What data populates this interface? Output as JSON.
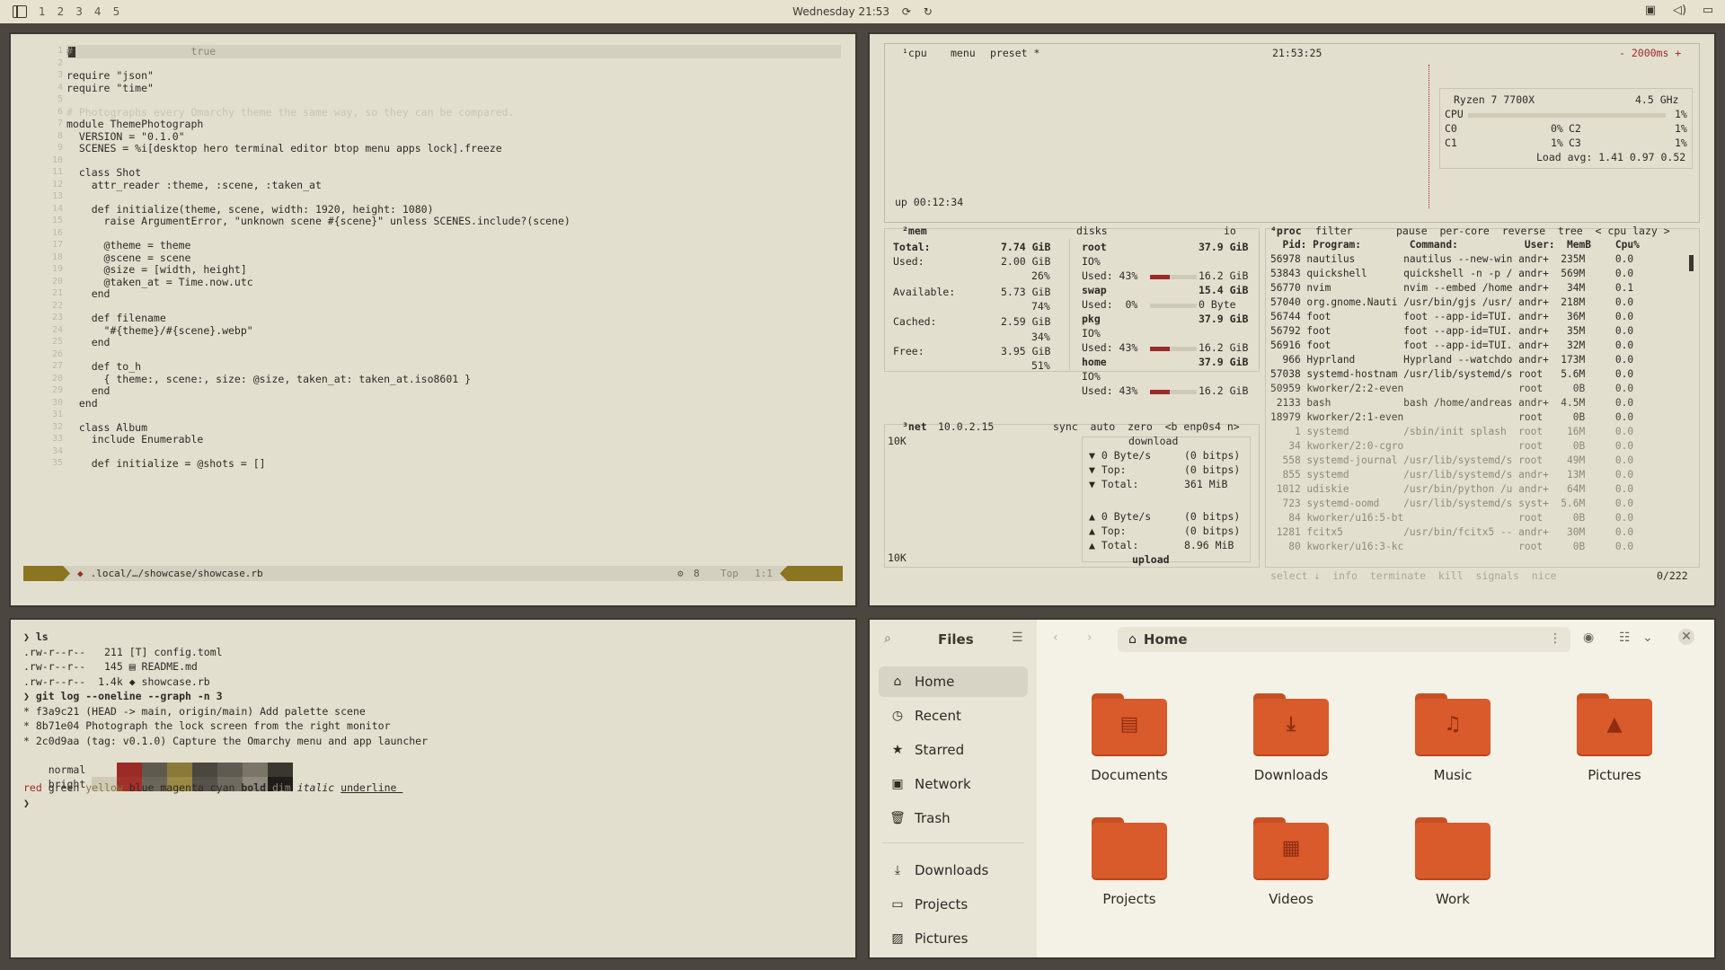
{
  "topbar": {
    "workspaces": [
      "1",
      "2",
      "3",
      "4",
      "5"
    ],
    "clock": "Wednesday 21:53"
  },
  "editor": {
    "lines": [
      {
        "n": "1",
        "t": "#                   true"
      },
      {
        "n": "2",
        "t": ""
      },
      {
        "n": "3",
        "t": "require \"json\""
      },
      {
        "n": "4",
        "t": "require \"time\""
      },
      {
        "n": "5",
        "t": ""
      },
      {
        "n": "6",
        "t": "# Photographs every Omarchy theme the same way, so they can be compared."
      },
      {
        "n": "7",
        "t": "module ThemePhotograph"
      },
      {
        "n": "8",
        "t": "  VERSION = \"0.1.0\""
      },
      {
        "n": "9",
        "t": "  SCENES = %i[desktop hero terminal editor btop menu apps lock].freeze"
      },
      {
        "n": "10",
        "t": ""
      },
      {
        "n": "11",
        "t": "  class Shot"
      },
      {
        "n": "12",
        "t": "    attr_reader :theme, :scene, :taken_at"
      },
      {
        "n": "13",
        "t": ""
      },
      {
        "n": "14",
        "t": "    def initialize(theme, scene, width: 1920, height: 1080)"
      },
      {
        "n": "15",
        "t": "      raise ArgumentError, \"unknown scene #{scene}\" unless SCENES.include?(scene)"
      },
      {
        "n": "16",
        "t": ""
      },
      {
        "n": "17",
        "t": "      @theme = theme"
      },
      {
        "n": "18",
        "t": "      @scene = scene"
      },
      {
        "n": "19",
        "t": "      @size = [width, height]"
      },
      {
        "n": "20",
        "t": "      @taken_at = Time.now.utc"
      },
      {
        "n": "21",
        "t": "    end"
      },
      {
        "n": "22",
        "t": ""
      },
      {
        "n": "23",
        "t": "    def filename"
      },
      {
        "n": "24",
        "t": "      \"#{theme}/#{scene}.webp\""
      },
      {
        "n": "25",
        "t": "    end"
      },
      {
        "n": "26",
        "t": ""
      },
      {
        "n": "27",
        "t": "    def to_h"
      },
      {
        "n": "28",
        "t": "      { theme:, scene:, size: @size, taken_at: taken_at.iso8601 }"
      },
      {
        "n": "29",
        "t": "    end"
      },
      {
        "n": "30",
        "t": "  end"
      },
      {
        "n": "31",
        "t": ""
      },
      {
        "n": "32",
        "t": "  class Album"
      },
      {
        "n": "33",
        "t": "    include Enumerable"
      },
      {
        "n": "34",
        "t": ""
      },
      {
        "n": "35",
        "t": "    def initialize = @shots = []"
      }
    ],
    "status_file": ".local/…/showcase/showcase.rb",
    "status_count": "8",
    "status_pos": "Top",
    "status_rowcol": "1:1"
  },
  "btop": {
    "cpu_tab": "¹cpu",
    "menu": "menu",
    "preset": "preset *",
    "time": "21:53:25",
    "interval": "- 2000ms +",
    "cpu_model": "Ryzen 7 7700X",
    "cpu_freq": "4.5 GHz",
    "cpu_total_label": "CPU",
    "cpu_total_pct": "1%",
    "cores": [
      {
        "name": "C0",
        "pct": "0%"
      },
      {
        "name": "C2",
        "pct": "1%"
      },
      {
        "name": "C1",
        "pct": "1%"
      },
      {
        "name": "C3",
        "pct": "1%"
      }
    ],
    "load": "Load avg: 1.41 0.97 0.52",
    "uptime": "up 00:12:34",
    "mem_tab": "²mem",
    "disks_tab": "disks",
    "io_tab": "io",
    "mem": {
      "total_l": "Total:",
      "total_v": "7.74 GiB",
      "used_l": "Used:",
      "used_v": "2.00 GiB",
      "used_p": "26%",
      "avail_l": "Available:",
      "avail_v": "5.73 GiB",
      "avail_p": "74%",
      "cached_l": "Cached:",
      "cached_v": "2.59 GiB",
      "cached_p": "34%",
      "free_l": "Free:",
      "free_v": "3.95 GiB",
      "free_p": "51%"
    },
    "disks": [
      {
        "name": "root",
        "size": "37.9 GiB",
        "io": "IO%",
        "used": "Used: 43%",
        "usedv": "16.2 GiB"
      },
      {
        "name": "swap",
        "size": "15.4 GiB",
        "io": "",
        "used": "Used:  0%",
        "usedv": "0 Byte"
      },
      {
        "name": "pkg",
        "size": "37.9 GiB",
        "io": "IO%",
        "used": "Used: 43%",
        "usedv": "16.2 GiB"
      },
      {
        "name": "home",
        "size": "37.9 GiB",
        "io": "IO%",
        "used": "Used: 43%",
        "usedv": "16.2 GiB"
      }
    ],
    "net_tab": "³net",
    "net_ip": "10.0.2.15",
    "net_opts": "sync  auto  zero  <b enp0s4 n>",
    "net_scale_top": "10K",
    "net_scale_bot": "10K",
    "download": "download",
    "upload": "upload",
    "dl_rows": [
      {
        "l": "▼ 0 Byte/s",
        "r": "(0 bitps)"
      },
      {
        "l": "▼ Top:",
        "r": "(0 bitps)"
      },
      {
        "l": "▼ Total:",
        "r": "361 MiB"
      }
    ],
    "ul_rows": [
      {
        "l": "▲ 0 Byte/s",
        "r": "(0 bitps)"
      },
      {
        "l": "▲ Top:",
        "r": "(0 bitps)"
      },
      {
        "l": "▲ Total:",
        "r": "8.96 MiB"
      }
    ],
    "proc_tab": "⁴proc",
    "proc_opts": "filter       pause  per-core  reverse  tree  < cpu lazy >",
    "proc_header": "  Pid: Program:        Command:           User:  MemB    Cpu%",
    "procs": [
      "56978 nautilus        nautilus --new-win andr+  235M     0.0",
      "53843 quickshell      quickshell -n -p / andr+  569M     0.0",
      "56770 nvim            nvim --embed /home andr+   34M     0.1",
      "57040 org.gnome.Nauti /usr/bin/gjs /usr/ andr+  218M     0.0",
      "56744 foot            foot --app-id=TUI. andr+   36M     0.0",
      "56792 foot            foot --app-id=TUI. andr+   35M     0.0",
      "56916 foot            foot --app-id=TUI. andr+   32M     0.0",
      "  966 Hyprland        Hyprland --watchdo andr+  173M     0.0",
      "57038 systemd-hostnam /usr/lib/systemd/s root   5.6M     0.0",
      "50959 kworker/2:2-even                   root     0B     0.0",
      " 2133 bash            bash /home/andreas andr+  4.5M     0.0",
      "18979 kworker/2:1-even                   root     0B     0.0",
      "    1 systemd         /sbin/init splash  root    16M     0.0",
      "   34 kworker/2:0-cgro                   root     0B     0.0",
      "  558 systemd-journal /usr/lib/systemd/s root    49M     0.0",
      "  855 systemd         /usr/lib/systemd/s andr+   13M     0.0",
      " 1012 udiskie         /usr/bin/python /u andr+   64M     0.0",
      "  723 systemd-oomd    /usr/lib/systemd/s syst+  5.6M     0.0",
      "   84 kworker/u16:5-bt                   root     0B     0.0",
      " 1281 fcitx5          /usr/bin/fcitx5 -- andr+   30M     0.0",
      "   80 kworker/u16:3-kc                   root     0B     0.0"
    ],
    "proc_footer": "select ↓  info  terminate  kill  signals  nice",
    "proc_count": "0/222"
  },
  "terminal": {
    "lines": [
      "❯ ls",
      ".rw-r--r--   211 [T] config.toml",
      ".rw-r--r--   145 ▤ README.md",
      ".rw-r--r--  1.4k ◆ showcase.rb",
      "❯ git log --oneline --graph -n 3",
      "* f3a9c21 (HEAD -> main, origin/main) Add palette scene",
      "* 8b71e04 Photograph the lock screen from the right monitor",
      "* 2c0d9aa (tag: v0.1.0) Capture the Omarchy menu and app launcher"
    ],
    "normal": "normal",
    "bright": "bright",
    "normal_colors": [
      "#e3dfcf",
      "#9b2b26",
      "#5e5a4d",
      "#8a7a3a",
      "#4a4740",
      "#5f5b52",
      "#7a7567",
      "#3a372e"
    ],
    "bright_colors": [
      "#cfcab8",
      "#a3312b",
      "#6a665a",
      "#9a8a45",
      "#55524a",
      "#6e6a60",
      "#8e897c",
      "#1f1d19"
    ],
    "styles": [
      "red",
      "green",
      "yellow",
      "blue",
      "magenta",
      "cyan",
      "bold",
      "dim",
      "italic",
      "underline"
    ],
    "prompt": "❯"
  },
  "files": {
    "title": "Files",
    "location": "Home",
    "sidebar": [
      {
        "label": "Home",
        "icon": "⌂"
      },
      {
        "label": "Recent",
        "icon": "◷"
      },
      {
        "label": "Starred",
        "icon": "★"
      },
      {
        "label": "Network",
        "icon": "▣"
      },
      {
        "label": "Trash",
        "icon": "🗑"
      }
    ],
    "bookmarks": [
      {
        "label": "Downloads",
        "icon": "⤓"
      },
      {
        "label": "Projects",
        "icon": "▭"
      },
      {
        "label": "Pictures",
        "icon": "▨"
      }
    ],
    "folders": [
      {
        "label": "Documents",
        "glyph": "▤"
      },
      {
        "label": "Downloads",
        "glyph": "⤓"
      },
      {
        "label": "Music",
        "glyph": "♫"
      },
      {
        "label": "Pictures",
        "glyph": "▲"
      },
      {
        "label": "Projects",
        "glyph": ""
      },
      {
        "label": "Videos",
        "glyph": "▦"
      },
      {
        "label": "Work",
        "glyph": ""
      }
    ]
  }
}
